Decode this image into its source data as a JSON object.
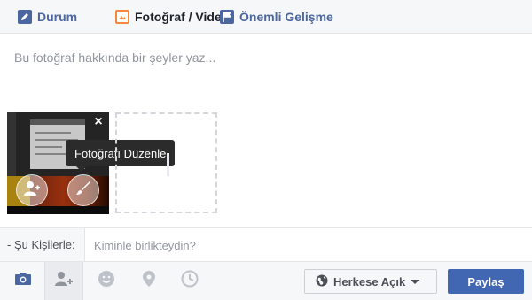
{
  "tabs": {
    "status": "Durum",
    "photo_video": "Fotoğraf / Video",
    "life_event": "Önemli Gelişme"
  },
  "composer": {
    "placeholder": "Bu fotoğraf hakkında bir şeyler yaz..."
  },
  "photo": {
    "remove_label": "×",
    "tooltip": "Fotoğrafı Düzenle"
  },
  "with_people": {
    "label": "- Şu Kişilerle:",
    "placeholder": "Kiminle birlikteydin?"
  },
  "footer": {
    "privacy_label": "Herkese Açık",
    "share_label": "Paylaş"
  },
  "colors": {
    "accent": "#4b67a1",
    "photo_tab": "#f5883a",
    "share_button": "#4267b2"
  }
}
